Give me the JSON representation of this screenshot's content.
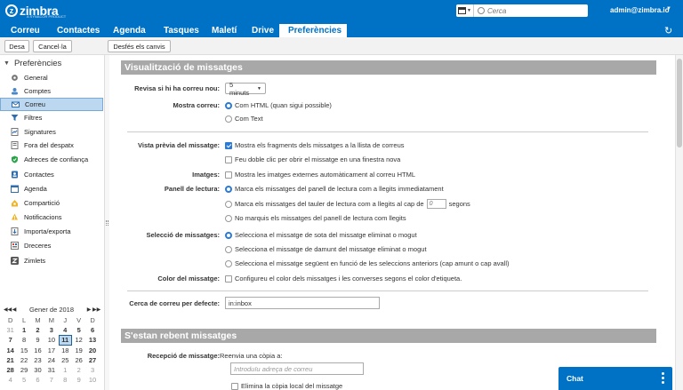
{
  "app": {
    "logo_text": "zimbra",
    "logo_sub": "A SYNACOR PRODUCT",
    "search_placeholder": "Cerca",
    "user": "admin@zimbra.io"
  },
  "tabs": [
    {
      "label": "Correu"
    },
    {
      "label": "Contactes"
    },
    {
      "label": "Agenda"
    },
    {
      "label": "Tasques"
    },
    {
      "label": "Maletí"
    },
    {
      "label": "Drive"
    },
    {
      "label": "Preferències",
      "active": true
    }
  ],
  "toolbar": {
    "save": "Desa",
    "cancel": "Cancel·la",
    "undo": "Desfés els canvis"
  },
  "sidebar": {
    "title": "Preferències",
    "items": [
      {
        "label": "General",
        "icon": "gear-icon"
      },
      {
        "label": "Comptes",
        "icon": "accounts-icon"
      },
      {
        "label": "Correu",
        "icon": "mail-icon",
        "active": true
      },
      {
        "label": "Filtres",
        "icon": "filter-icon"
      },
      {
        "label": "Signatures",
        "icon": "signature-icon"
      },
      {
        "label": "Fora del despatx",
        "icon": "out-of-office-icon"
      },
      {
        "label": "Adreces de confiança",
        "icon": "shield-icon"
      },
      {
        "label": "Contactes",
        "icon": "contacts-icon"
      },
      {
        "label": "Agenda",
        "icon": "calendar-icon"
      },
      {
        "label": "Compartició",
        "icon": "sharing-icon"
      },
      {
        "label": "Notificacions",
        "icon": "bell-icon"
      },
      {
        "label": "Importa/exporta",
        "icon": "import-export-icon"
      },
      {
        "label": "Dreceres",
        "icon": "shortcuts-icon"
      },
      {
        "label": "Zimlets",
        "icon": "zimlet-icon"
      }
    ]
  },
  "minical": {
    "title": "Gener de 2018",
    "nav": [
      "◀◀",
      "◀",
      "▶",
      "▶▶"
    ],
    "dow": [
      "D",
      "D",
      "D",
      "D",
      "D",
      "D",
      "D"
    ],
    "dow_labels": [
      "D",
      "L",
      "M",
      "M",
      "J",
      "V",
      "D"
    ],
    "weeks": [
      [
        "31",
        "1",
        "2",
        "3",
        "4",
        "5",
        "6"
      ],
      [
        "7",
        "8",
        "9",
        "10",
        "11",
        "12",
        "13"
      ],
      [
        "14",
        "15",
        "16",
        "17",
        "18",
        "19",
        "20"
      ],
      [
        "21",
        "22",
        "23",
        "24",
        "25",
        "26",
        "27"
      ],
      [
        "28",
        "29",
        "30",
        "31",
        "1",
        "2",
        "3"
      ],
      [
        "4",
        "5",
        "6",
        "7",
        "8",
        "9",
        "10"
      ]
    ],
    "today": "11"
  },
  "display": {
    "header": "Visualització de missatges",
    "check_label": "Revisa si hi ha correu nou:",
    "check_value": "5 minuts",
    "show_label": "Mostra correu:",
    "show_html": "Com HTML (quan sigui possible)",
    "show_text": "Com Text",
    "preview_label": "Vista prèvia del missatge:",
    "preview_fragments": "Mostra els fragments dels missatges a la llista de correus",
    "preview_dblclick": "Feu doble clic per obrir el missatge en una finestra nova",
    "images_label": "Imatges:",
    "images_opt": "Mostra les imatges externes automàticament al correu HTML",
    "reading_label": "Panell de lectura:",
    "reading_immediate": "Marca els missatges del panell de lectura com a llegits immediatament",
    "reading_after_pre": "Marca els missatges del tauler de lectura com a llegits al cap de",
    "reading_after_value": "0",
    "reading_after_post": "segons",
    "reading_never": "No marquis els missatges del panell de lectura com llegits",
    "selection_label": "Selecció de missatges:",
    "selection_below": "Selecciona el missatge de sota del missatge eliminat o mogut",
    "selection_above": "Selecciona el missatge de damunt del missatge eliminat o mogut",
    "selection_next": "Selecciona el missatge següent en funció de les seleccions anteriors (cap amunt o cap avall)",
    "color_label": "Color del missatge:",
    "color_opt": "Configureu el color dels missatges i les converses segons el color d'etiqueta.",
    "default_search_label": "Cerca de correu per defecte:",
    "default_search_value": "in:inbox"
  },
  "receiving": {
    "header": "S'estan rebent missatges",
    "receipt_label": "Recepció de missatge:",
    "forward_text": "Reenvia una còpia a:",
    "forward_placeholder": "Introduïu adreça de correu",
    "delete_local": "Elimina la còpia local del missatge"
  },
  "chat": {
    "label": "Chat"
  },
  "colors": {
    "brand": "#0072c6",
    "section_header": "#a8a8a8",
    "selected": "#bcd8f0"
  }
}
